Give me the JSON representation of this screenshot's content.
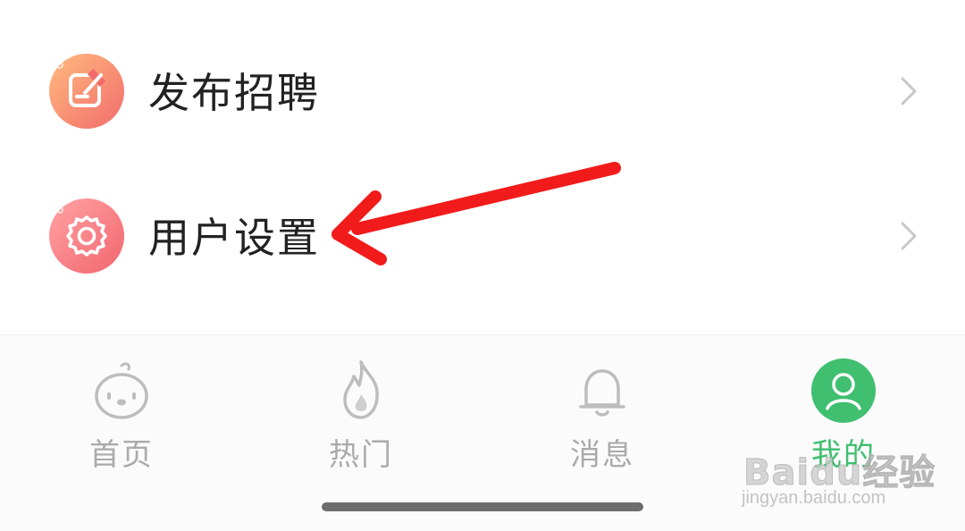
{
  "menu": {
    "items": [
      {
        "label": "发布招聘",
        "icon": "post-job-icon",
        "chevron": "chevron-right-icon"
      },
      {
        "label": "用户设置",
        "icon": "gear-icon",
        "chevron": "chevron-right-icon"
      }
    ]
  },
  "tabbar": {
    "tabs": [
      {
        "label": "首页",
        "icon": "home-mascot-icon",
        "active": false
      },
      {
        "label": "热门",
        "icon": "flame-icon",
        "active": false
      },
      {
        "label": "消息",
        "icon": "bell-icon",
        "active": false
      },
      {
        "label": "我的",
        "icon": "user-icon",
        "active": true
      }
    ],
    "active_color": "#3fbf6f",
    "inactive_color": "#aaaaaa"
  },
  "watermark": {
    "logo": "Baidu经验",
    "url": "jingyan.baidu.com"
  },
  "annotation": {
    "arrow_color": "#f21b1b",
    "points_to": "用户设置"
  },
  "colors": {
    "post_icon_gradient": [
      "#ffb07a",
      "#f4736d"
    ],
    "settings_icon_gradient": [
      "#ff9a9a",
      "#f26b74"
    ]
  }
}
